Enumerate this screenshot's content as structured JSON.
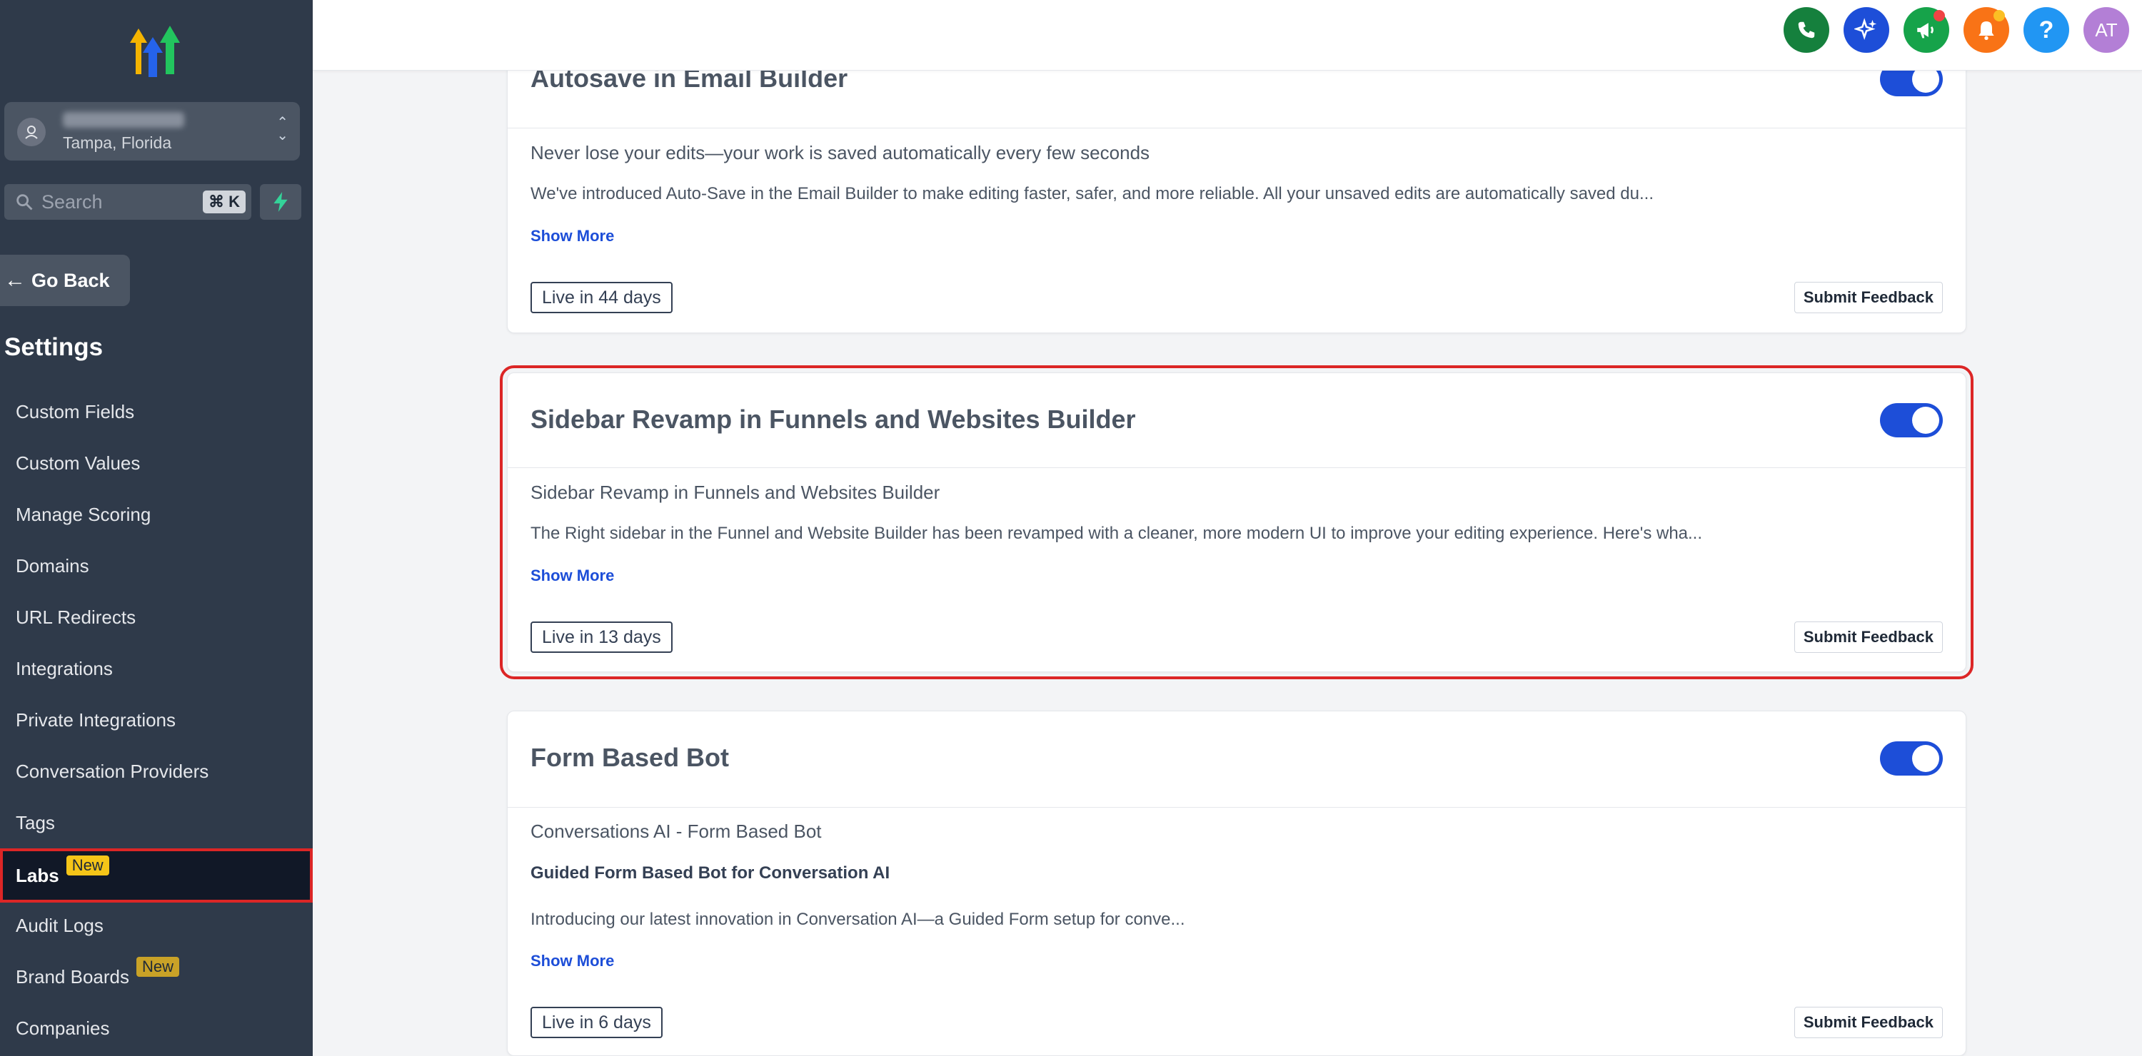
{
  "sidebar": {
    "location": {
      "city": "Tampa, Florida"
    },
    "search": {
      "placeholder": "Search",
      "shortcut": "⌘ K"
    },
    "go_back": "Go Back",
    "settings_title": "Settings",
    "items": [
      {
        "label": "Custom Fields"
      },
      {
        "label": "Custom Values"
      },
      {
        "label": "Manage Scoring"
      },
      {
        "label": "Domains"
      },
      {
        "label": "URL Redirects"
      },
      {
        "label": "Integrations"
      },
      {
        "label": "Private Integrations"
      },
      {
        "label": "Conversation Providers"
      },
      {
        "label": "Tags"
      },
      {
        "label": "Labs",
        "badge": "New",
        "active": true
      },
      {
        "label": "Audit Logs"
      },
      {
        "label": "Brand Boards",
        "badge": "New"
      },
      {
        "label": "Companies"
      }
    ]
  },
  "topbar": {
    "icons": [
      "phone-icon",
      "sparkle-icon",
      "megaphone-icon",
      "bell-icon",
      "help-icon"
    ],
    "avatar_initials": "AT",
    "colors": {
      "phone": "#15803d",
      "sparkle": "#1d4ed8",
      "megaphone": "#16a34a",
      "bell": "#f97316",
      "help": "#2196f3",
      "avatar": "#b37fd6"
    }
  },
  "cards": [
    {
      "title": "Autosave in Email Builder",
      "subtitle": "Never lose your edits—your work is saved automatically every few seconds",
      "description": "We've introduced Auto-Save in the Email Builder to make editing faster, safer, and more reliable. All your unsaved edits are automatically saved du...",
      "show_more": "Show More",
      "live": "Live in 44 days",
      "feedback": "Submit Feedback"
    },
    {
      "title": "Sidebar Revamp in Funnels and Websites Builder",
      "subtitle": "Sidebar Revamp in Funnels and Websites Builder",
      "description": "The Right sidebar in the Funnel and Website Builder has been revamped with a cleaner, more modern UI to improve your editing experience. Here's wha...",
      "show_more": "Show More",
      "live": "Live in 13 days",
      "feedback": "Submit Feedback"
    },
    {
      "title": "Form Based Bot",
      "subtitle": "Conversations AI - Form Based Bot",
      "bold_line": "Guided Form Based Bot for Conversation AI",
      "description": "Introducing our latest innovation in Conversation AI—a Guided Form setup for conve...",
      "show_more": "Show More",
      "live": "Live in 6 days",
      "feedback": "Submit Feedback"
    }
  ],
  "accent": {
    "primary": "#1d4ed8",
    "highlight": "#dc2626",
    "sidebar_bg": "#2f3a4a"
  }
}
